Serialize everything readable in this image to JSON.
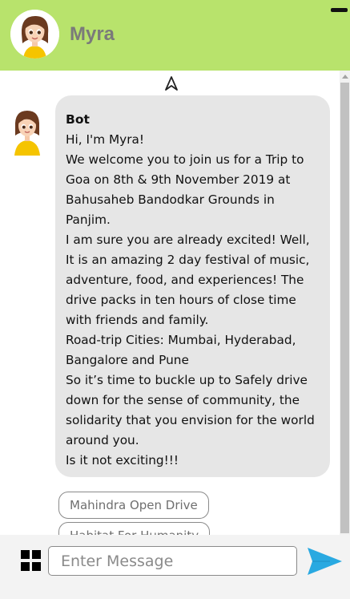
{
  "header": {
    "name": "Myra",
    "avatar_icon": "female-avatar-icon",
    "minimize_icon": "minimize-icon",
    "background_color": "#b8e36c"
  },
  "chat": {
    "nav_icon": "navigation-arrow-icon",
    "message": {
      "sender": "Bot",
      "lines": [
        "Hi, I'm Myra!",
        "We welcome you to join us for a Trip to Goa on 8th & 9th November 2019 at Bahusaheb Bandodkar Grounds in Panjim.",
        "I am sure you are already excited! Well, It is an amazing 2 day festival of music, adventure, food, and experiences! The drive packs in ten hours of close time with friends and family.",
        "Road-trip Cities: Mumbai, Hyderabad, Bangalore and Pune",
        "So it’s time to buckle up to Safely drive down for the sense of community, the solidarity that you envision for the world around you.",
        "Is it not exciting!!!"
      ]
    },
    "options": [
      "Mahindra Open Drive",
      "Habitat For Humanity"
    ]
  },
  "footer": {
    "menu_icon": "grid-menu-icon",
    "input_placeholder": "Enter Message",
    "input_value": "",
    "send_icon": "send-icon",
    "send_color": "#29a9e1"
  }
}
